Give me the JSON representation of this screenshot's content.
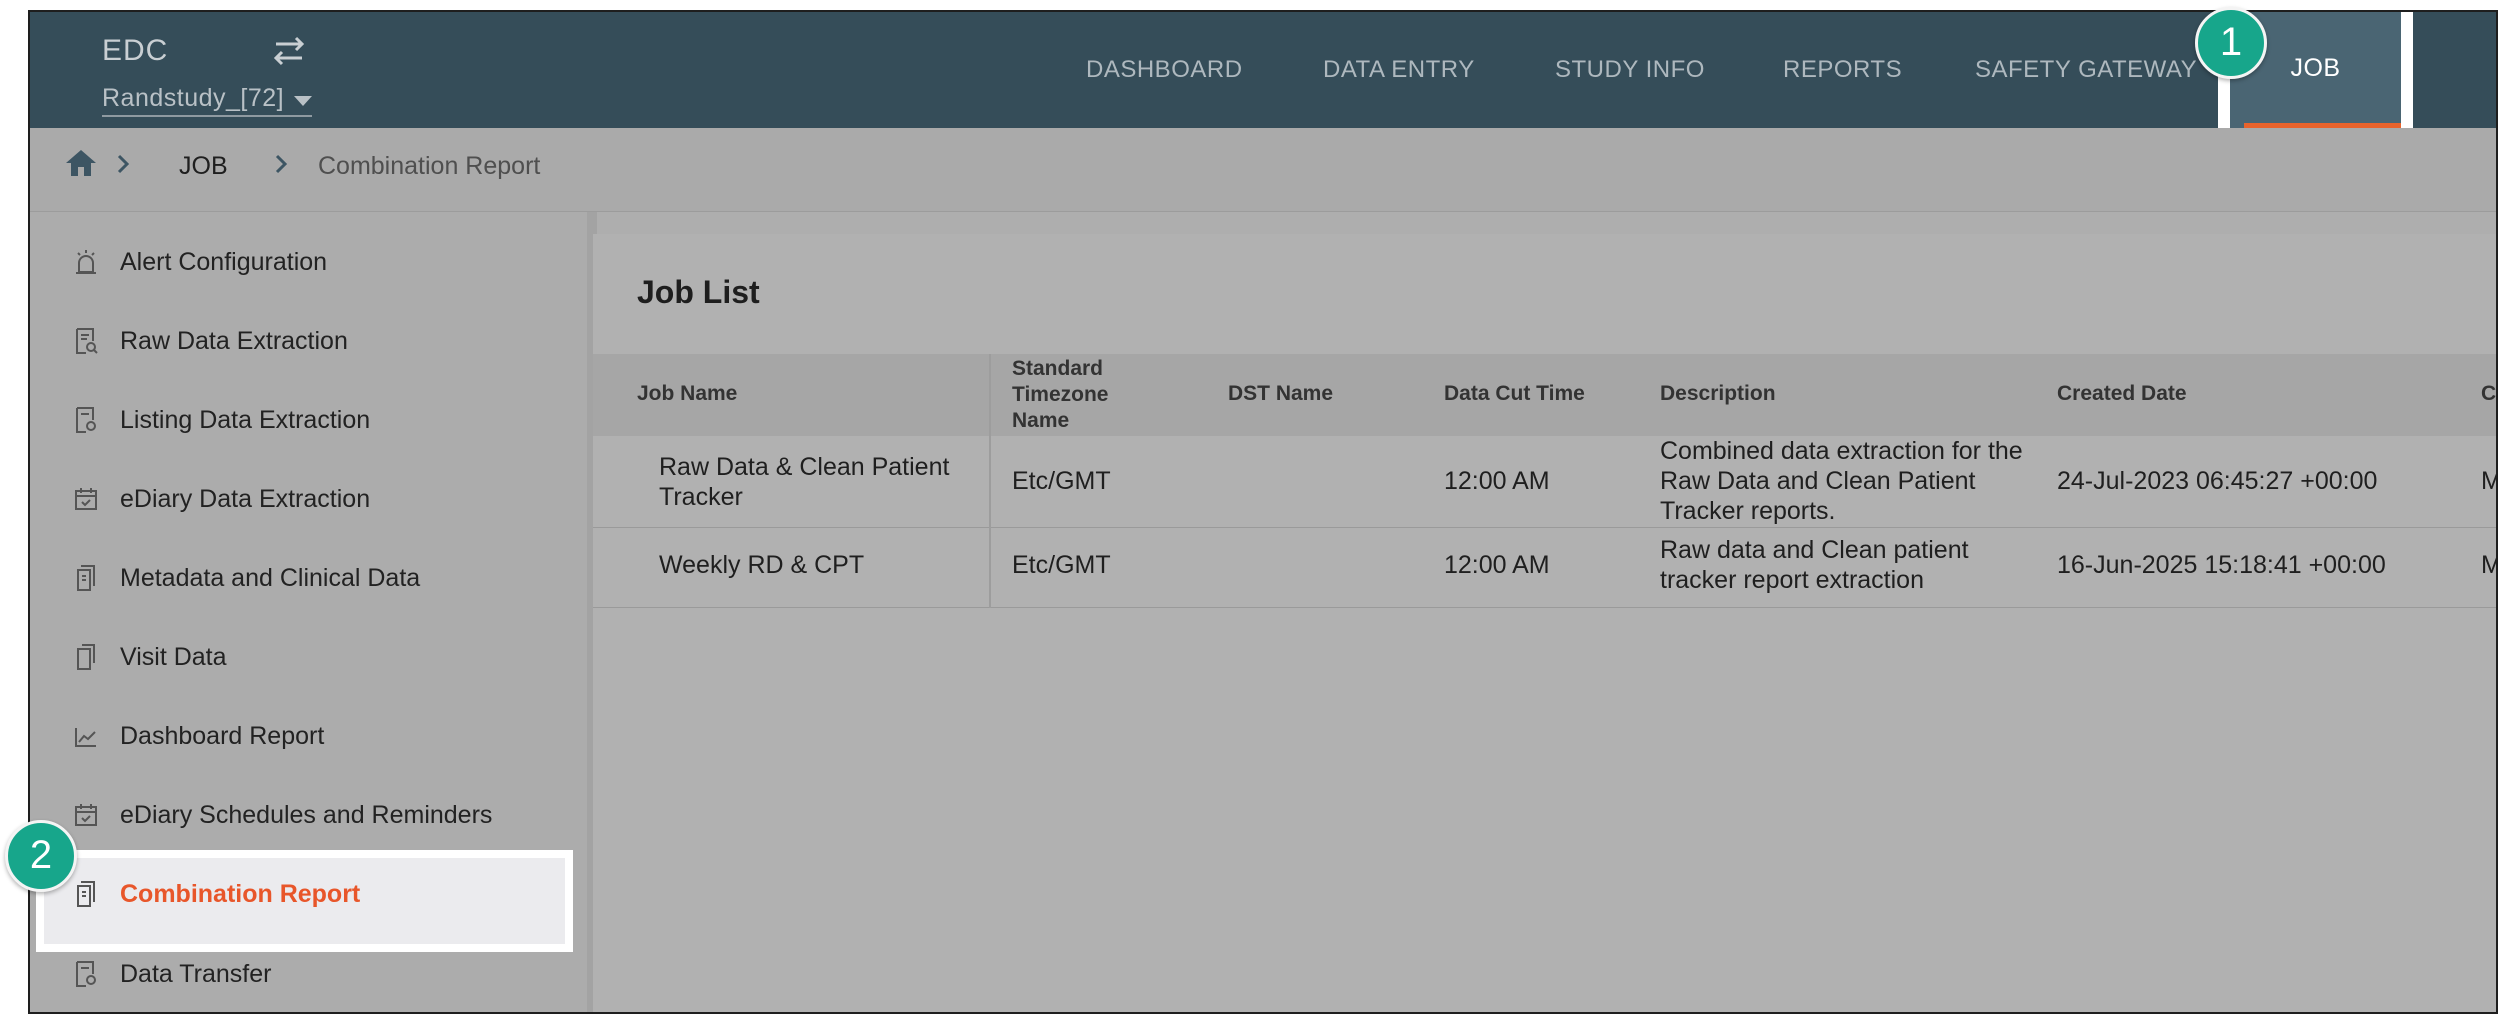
{
  "header": {
    "app_name": "EDC",
    "study_selector": "Randstudy_[72]",
    "nav": [
      {
        "label": "DASHBOARD"
      },
      {
        "label": "DATA ENTRY"
      },
      {
        "label": "STUDY INFO"
      },
      {
        "label": "REPORTS"
      },
      {
        "label": "SAFETY GATEWAY"
      },
      {
        "label": "JOB"
      }
    ],
    "active_nav": "JOB"
  },
  "breadcrumb": {
    "items": [
      "JOB",
      "Combination Report"
    ]
  },
  "sidebar": {
    "items": [
      {
        "label": "Alert Configuration",
        "icon": "alarm-icon"
      },
      {
        "label": "Raw Data Extraction",
        "icon": "document-search-icon"
      },
      {
        "label": "Listing Data Extraction",
        "icon": "document-list-icon"
      },
      {
        "label": "eDiary Data Extraction",
        "icon": "calendar-check-icon"
      },
      {
        "label": "Metadata and Clinical Data",
        "icon": "documents-icon"
      },
      {
        "label": "Visit Data",
        "icon": "copy-icon"
      },
      {
        "label": "Dashboard Report",
        "icon": "line-chart-icon"
      },
      {
        "label": "eDiary Schedules and Reminders",
        "icon": "calendar-check-icon"
      },
      {
        "label": "Combination Report",
        "icon": "documents-icon",
        "active": true
      },
      {
        "label": "Data Transfer",
        "icon": "document-transfer-icon"
      }
    ]
  },
  "job_list": {
    "title": "Job List",
    "columns": [
      "Job Name",
      "Standard Timezone Name",
      "DST Name",
      "Data Cut Time",
      "Description",
      "Created Date",
      "Cre"
    ],
    "rows": [
      {
        "job_name": "Raw Data & Clean Patient Tracker",
        "timezone": "Etc/GMT",
        "dst_name": "",
        "data_cut_time": "12:00 AM",
        "description": "Combined data extraction for the Raw Data and Clean Patient Tracker reports.",
        "created_date": "24-Jul-2023 06:45:27 +00:00",
        "created_by": "Ma"
      },
      {
        "job_name": "Weekly RD & CPT",
        "timezone": "Etc/GMT",
        "dst_name": "",
        "data_cut_time": "12:00 AM",
        "description": "Raw data and Clean patient tracker report extraction",
        "created_date": "16-Jun-2025 15:18:41 +00:00",
        "created_by": "Ma"
      }
    ]
  },
  "callouts": [
    "1",
    "2"
  ],
  "colors": {
    "header_bg": "#354d59",
    "active_tab_bg": "#4a6573",
    "accent_orange": "#e8632c",
    "callout_teal": "#17a68b"
  }
}
